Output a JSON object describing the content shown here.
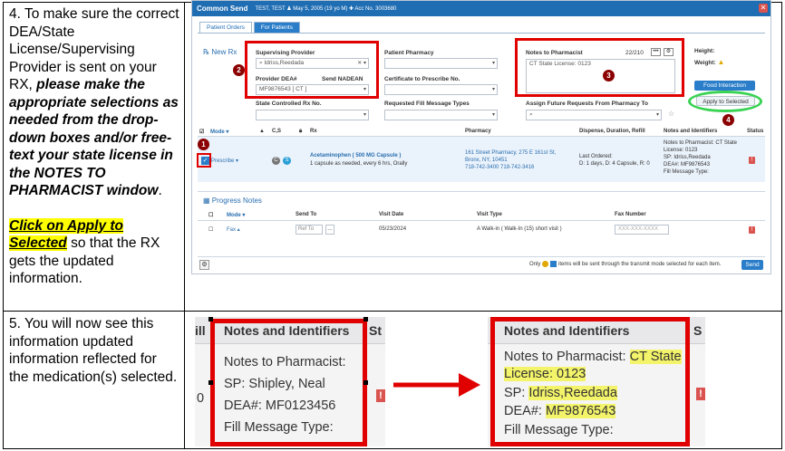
{
  "step4": {
    "lead": "4. To make sure the correct DEA/State License/Supervising Provider is sent on your RX, ",
    "emphasis": "please make the appropriate selections as needed from the drop-down boxes and/or free-text your state license in the NOTES TO PHARMACIST window",
    "end": ".",
    "apply_link": "Click on Apply to Selected",
    "apply_tail": " so that the RX gets the updated information."
  },
  "step5": {
    "text": "5. You will now see this information updated information reflected for the medication(s) selected."
  },
  "app": {
    "title": "Common Send",
    "patient": "TEST, TEST  ♟ May 5, 2005 (19 yo M)  ✚ Acc No. 3003680",
    "tabs": [
      "Patient Orders",
      "For Patients"
    ],
    "new_rx": "New Rx",
    "supervising_provider_label": "Supervising Provider",
    "supervising_provider_value": "Idriss,Reedada",
    "provider_dea_label": "Provider DEA#",
    "provider_dea_value": "MF9876543 [ CT ]",
    "send_nadean_label": "Send NADEAN",
    "patient_pharmacy_label": "Patient Pharmacy",
    "certificate_label": "Certificate to Prescribe No.",
    "state_controlled_label": "State Controlled Rx No.",
    "requested_fill_label": "Requested Fill Message Types",
    "notes_label": "Notes to Pharmacist",
    "notes_count": "22/210",
    "notes_value": "CT State License: 0123",
    "assign_future_label": "Assign Future Requests From Pharmacy To",
    "height_label": "Height:",
    "weight_label": "Weight:",
    "food_btn": "Food Interaction",
    "apply_btn": "Apply to Selected",
    "callouts": [
      "1",
      "2",
      "3",
      "4"
    ],
    "table_headers": {
      "mode": "Mode ▾",
      "cs": "C,S",
      "rx": "Rx",
      "pharmacy": "Pharmacy",
      "dispense": "Dispense, Duration, Refill",
      "notes": "Notes and Identifiers",
      "status": "Status"
    },
    "row": {
      "mode": "Prescribe ▾",
      "drug": "Acetaminophen ( 500 MG Capsule )",
      "sig": "1 capsule as needed, every 6 hrs, Orally",
      "pharmacy_addr": "161 Street Pharmacy, 275 E 161st St,",
      "pharmacy_city": "Bronx, NY, 10451",
      "pharmacy_phone": "718-742-3400   718-742-3416",
      "last_ordered": "Last Ordered:",
      "dispense": "D: 1 days, D: 4 Capsule, R: 0",
      "notes_line1": "Notes to Pharmacist: CT State",
      "notes_line2": "License: 0123",
      "notes_line3": "SP: Idriss,Reedada",
      "notes_line4": "DEA#: MF9876543",
      "notes_line5": "Fill Message Type:",
      "status": "!"
    },
    "progress_title": "Progress Notes",
    "progress_headers": {
      "mode": "Mode ▾",
      "send_to": "Send To",
      "visit_date": "Visit Date",
      "visit_type": "Visit Type",
      "fax": "Fax Number"
    },
    "progress_row": {
      "mode": "Fax ▴",
      "send_to": "Ref To",
      "visit_date": "05/23/2024",
      "visit_type": "A Walk-in ( Walk-In (15) short visit )",
      "fax": "XXX-XXX-XXXX",
      "status": "!"
    },
    "footer_text": "items will be sent through the transmit mode selected for each item.",
    "footer_only": "Only",
    "send_btn": "Send"
  },
  "zoom_before": {
    "header": "Notes and Identifiers",
    "left_cut": "ill",
    "right_cut": "St",
    "row_cut": "0",
    "line1": "Notes to Pharmacist:",
    "line2": "SP: Shipley, Neal",
    "line3": "DEA#: MF0123456",
    "line4": "Fill Message Type:",
    "badge": "!"
  },
  "zoom_after": {
    "header": "Notes and Identifiers",
    "right_cut": "S",
    "line1a": "Notes to Pharmacist: ",
    "line1b": "CT State",
    "line2": "License: 0123",
    "line3a": "SP: ",
    "line3b": "Idriss,Reedada",
    "line4a": "DEA#: ",
    "line4b": "MF9876543",
    "line5": "Fill Message Type:",
    "badge": "!"
  },
  "colors": {
    "callout_red": "#e00000",
    "highlight_yellow": "#ffff00",
    "app_blue": "#1f6db3",
    "ring_green": "#39d353"
  }
}
